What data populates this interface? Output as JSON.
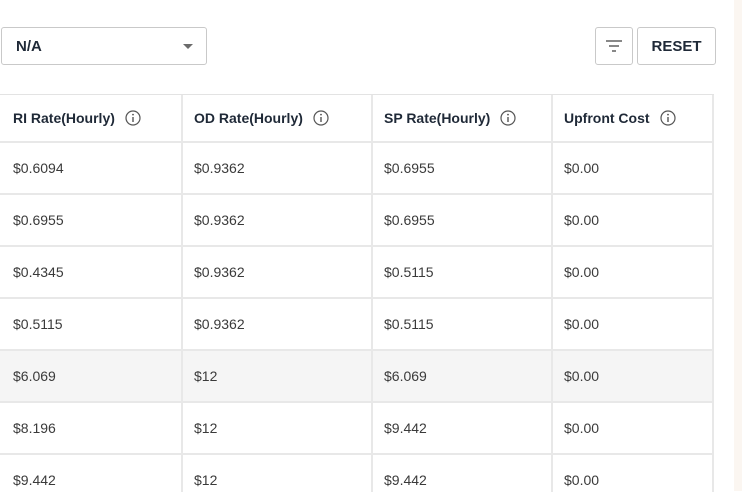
{
  "toolbar": {
    "select_value": "N/A",
    "reset_label": "RESET"
  },
  "table": {
    "headers": [
      "RI Rate(Hourly)",
      "OD Rate(Hourly)",
      "SP Rate(Hourly)",
      "Upfront Cost"
    ],
    "rows": [
      [
        "$0.6094",
        "$0.9362",
        "$0.6955",
        "$0.00"
      ],
      [
        "$0.6955",
        "$0.9362",
        "$0.6955",
        "$0.00"
      ],
      [
        "$0.4345",
        "$0.9362",
        "$0.5115",
        "$0.00"
      ],
      [
        "$0.5115",
        "$0.9362",
        "$0.5115",
        "$0.00"
      ],
      [
        "$6.069",
        "$12",
        "$6.069",
        "$0.00"
      ],
      [
        "$8.196",
        "$12",
        "$9.442",
        "$0.00"
      ],
      [
        "$9.442",
        "$12",
        "$9.442",
        "$0.00"
      ]
    ]
  },
  "icons": {
    "filter": "filter-icon",
    "info": "info-icon",
    "caret": "chevron-down-icon"
  },
  "colors": {
    "border": "#c9c9c9",
    "grid": "#e8e8e8",
    "row_highlight": "#f5f5f5",
    "text": "#1f2937"
  }
}
